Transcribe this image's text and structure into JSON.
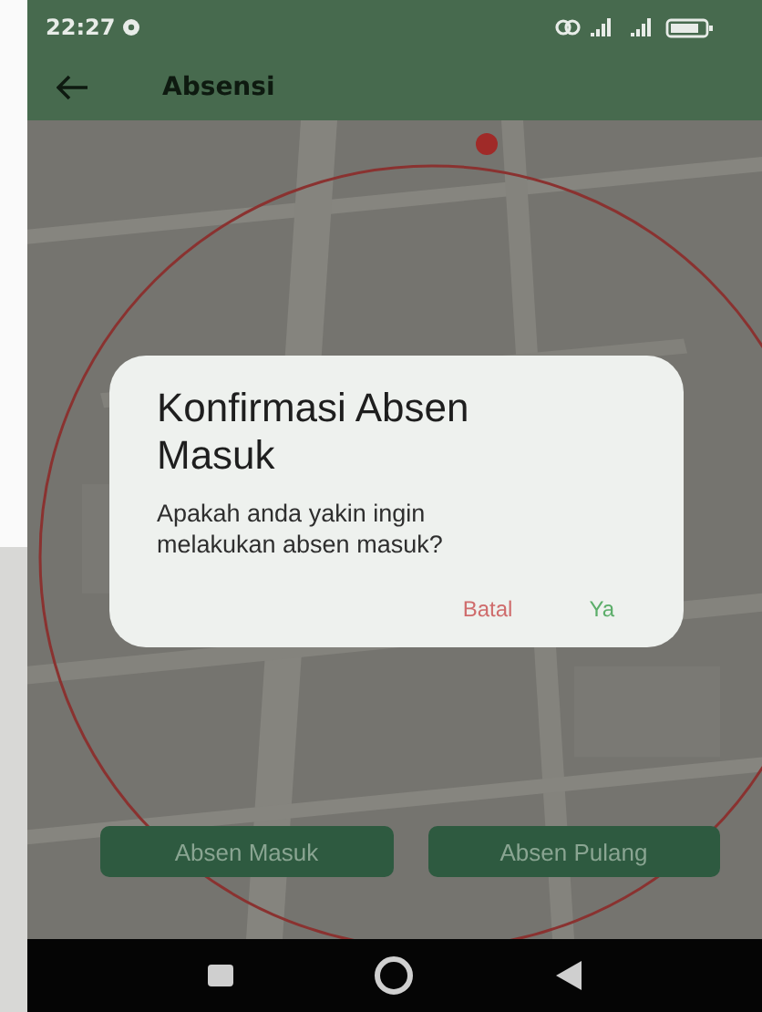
{
  "status_bar": {
    "time": "22:27"
  },
  "app_bar": {
    "title": "Absensi"
  },
  "dialog": {
    "title": "Konfirmasi Absen Masuk",
    "message": "Apakah anda yakin ingin melakukan absen masuk?",
    "buttons": [
      {
        "label": "Batal",
        "kind": "cancel"
      },
      {
        "label": "Ya",
        "kind": "confirm"
      }
    ]
  },
  "actions": [
    {
      "label": "Absen Masuk"
    },
    {
      "label": "Absen Pulang"
    }
  ]
}
